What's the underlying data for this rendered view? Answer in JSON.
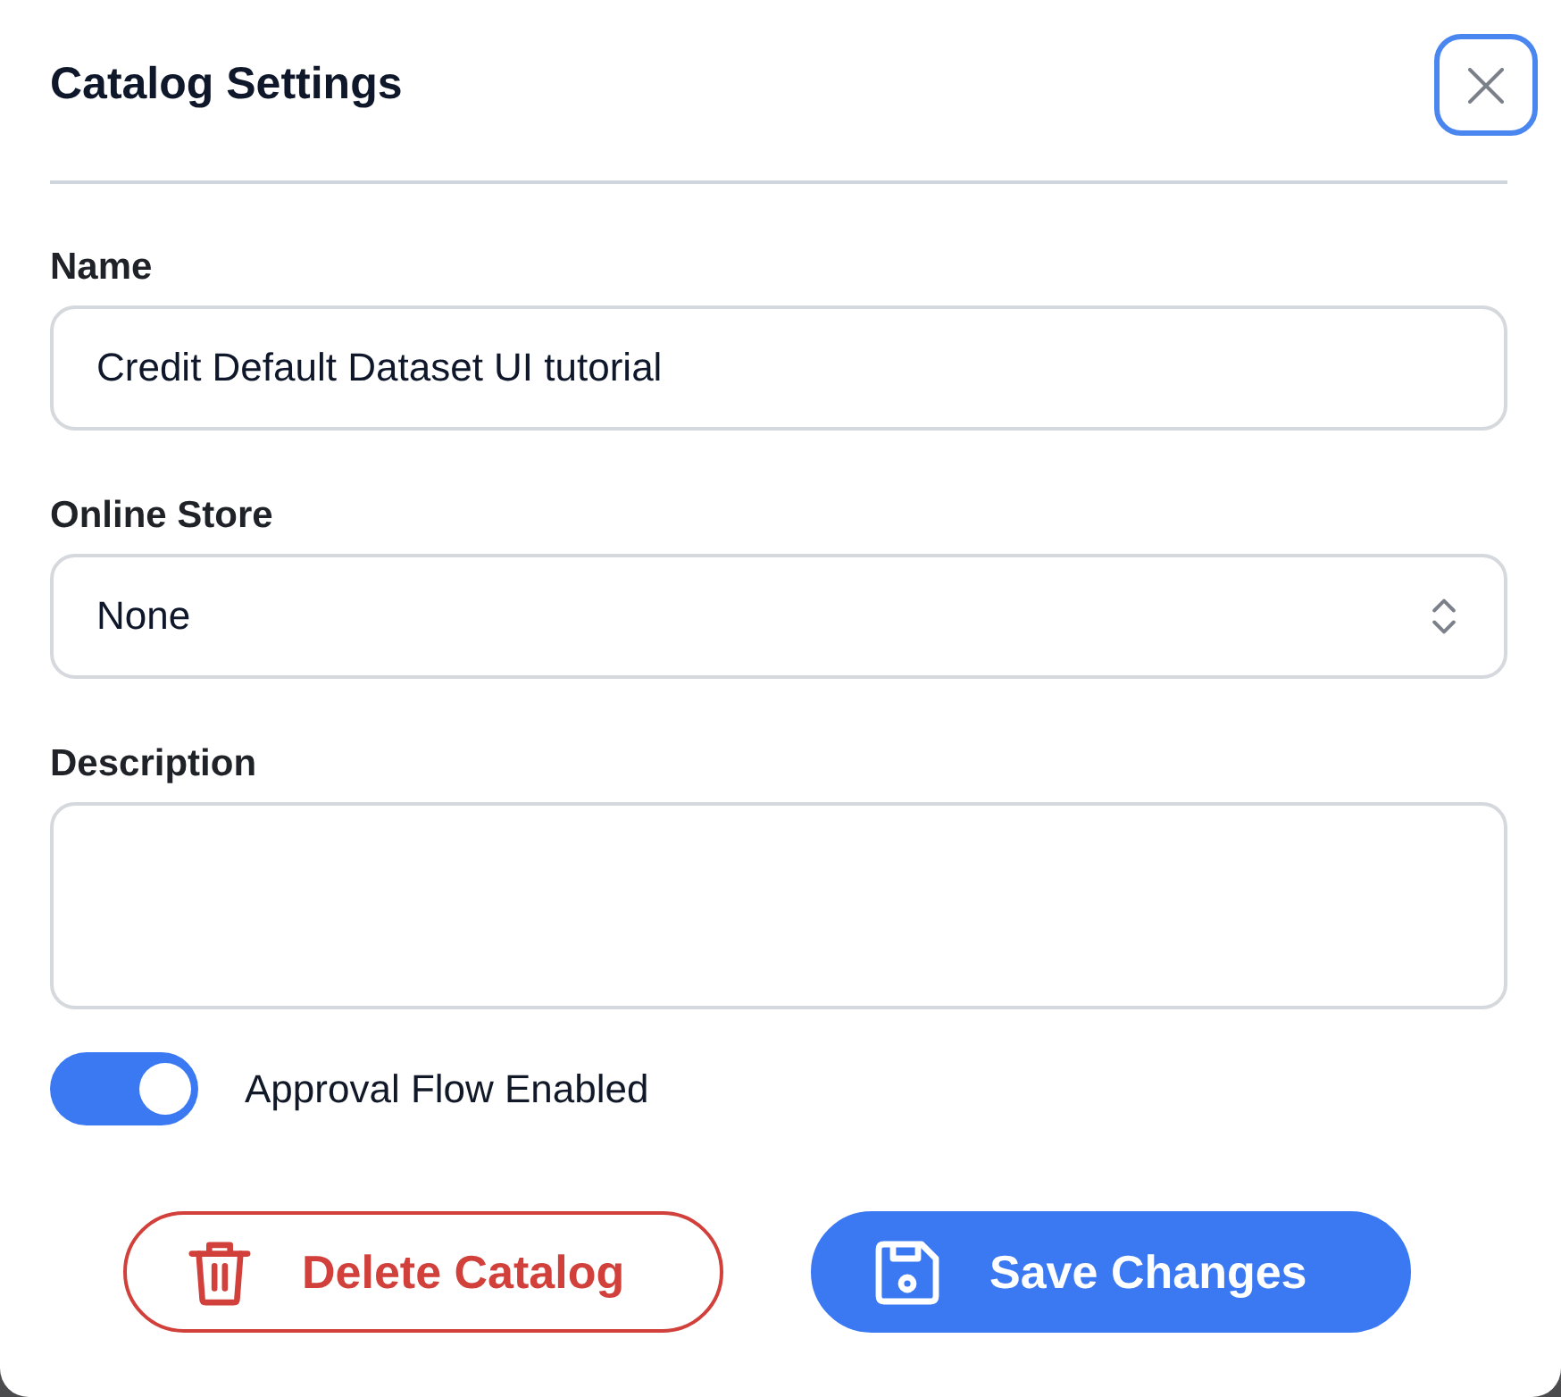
{
  "dialog": {
    "title": "Catalog Settings",
    "close_button": {
      "focused": true
    }
  },
  "fields": [
    {
      "kind": "text",
      "label": "Name",
      "value": "Credit Default Dataset UI tutorial"
    },
    {
      "kind": "select",
      "label": "Online Store",
      "value": "None"
    },
    {
      "kind": "textarea",
      "label": "Description"
    }
  ],
  "toggle": {
    "label": "Approval Flow Enabled",
    "on": true
  },
  "buttons": [
    {
      "kind": "danger",
      "label": "Delete Catalog"
    },
    {
      "kind": "primary",
      "label": "Save Changes"
    }
  ]
}
